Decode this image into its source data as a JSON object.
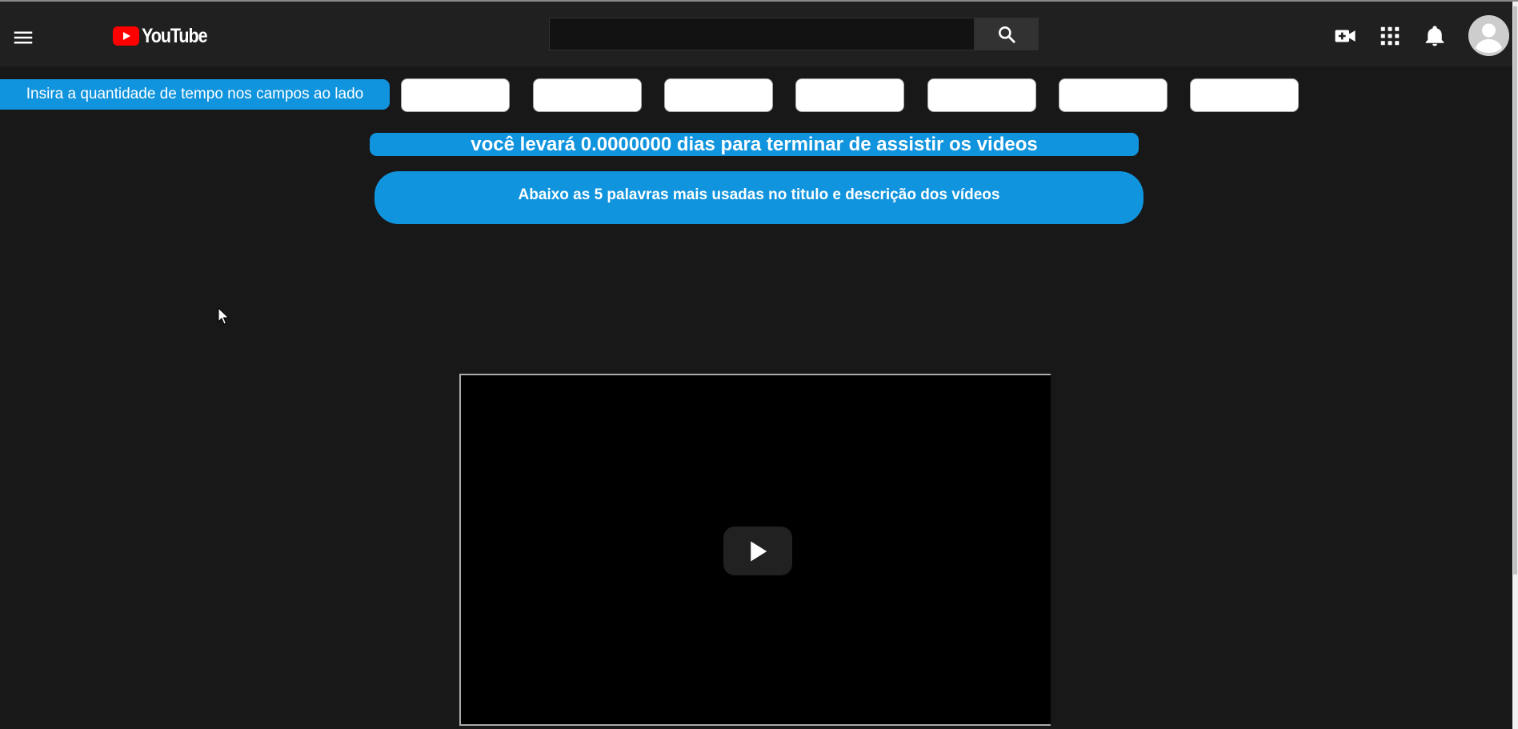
{
  "masthead": {
    "menu_icon": "hamburger-menu-icon",
    "logo_text": "YouTube",
    "brand_color": "#ff0000",
    "search": {
      "value": "",
      "placeholder": ""
    },
    "search_icon": "search-icon",
    "create_icon": "video-create-icon",
    "apps_icon": "apps-grid-icon",
    "notifications_icon": "bell-icon",
    "avatar_icon": "account-avatar-icon"
  },
  "extension": {
    "accent_color": "#1094de",
    "instruction_label": "Insira a quantidade de tempo nos campos ao lado",
    "time_inputs": [
      {
        "value": ""
      },
      {
        "value": ""
      },
      {
        "value": ""
      },
      {
        "value": ""
      },
      {
        "value": ""
      },
      {
        "value": ""
      },
      {
        "value": ""
      }
    ],
    "result_text": "você levará 0.0000000 dias para terminar de assistir os videos",
    "top_words_heading": "Abaixo as 5 palavras mais usadas no titulo e descrição dos vídeos"
  },
  "video_player": {
    "play_icon": "play-icon"
  }
}
